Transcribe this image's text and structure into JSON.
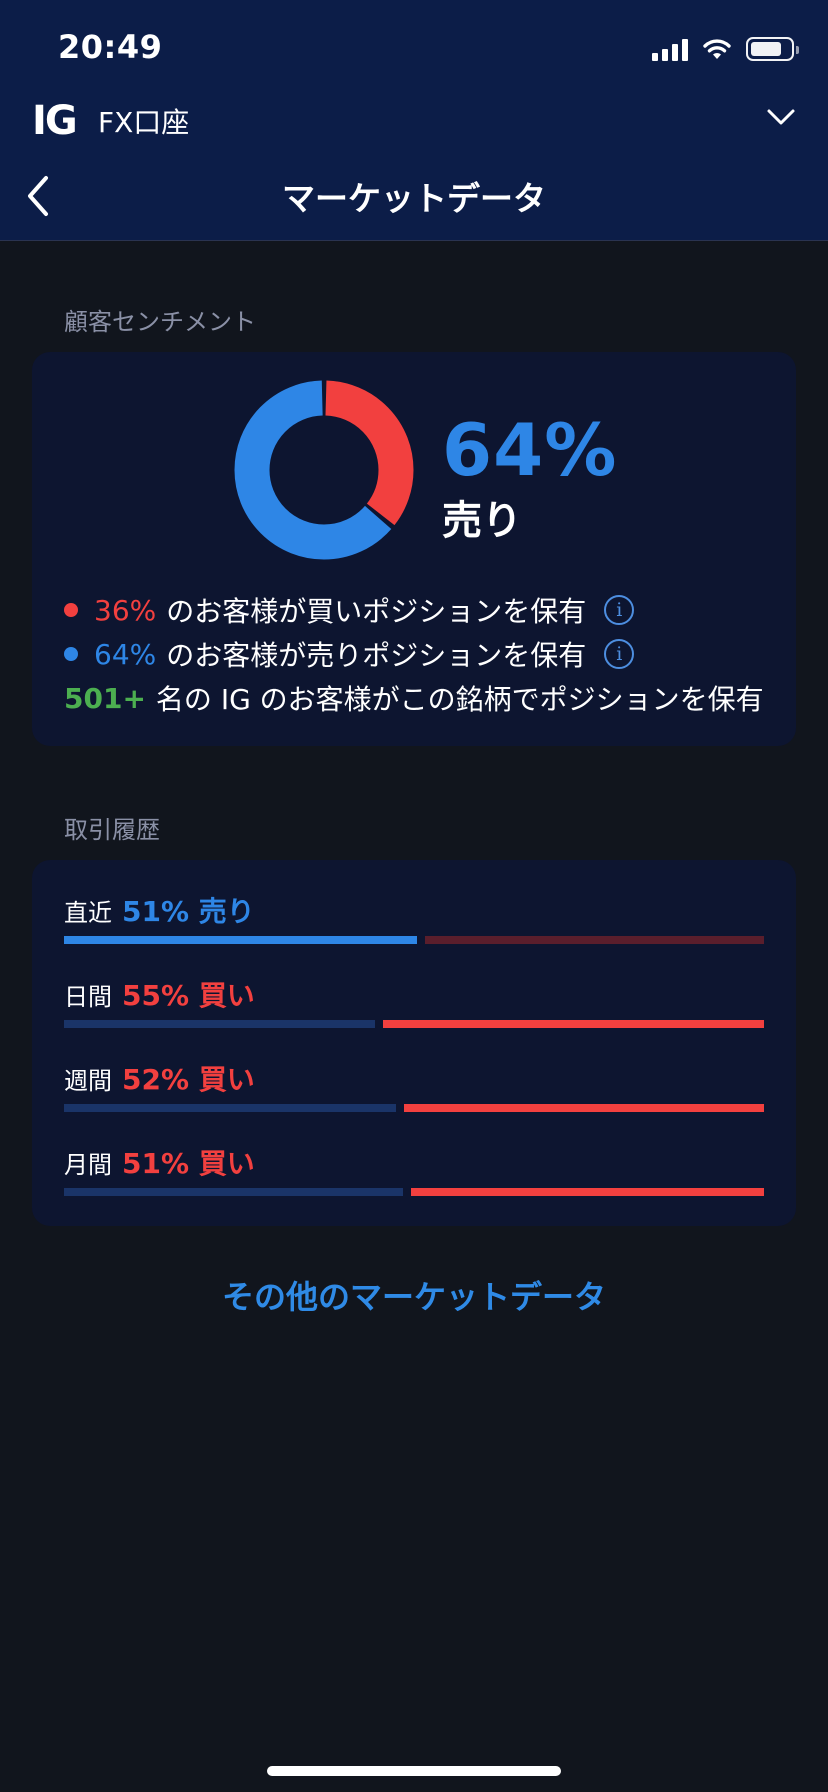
{
  "status_bar": {
    "time": "20:49"
  },
  "header": {
    "logo": "IG",
    "account": "FX口座",
    "title": "マーケットデータ"
  },
  "sentiment": {
    "section_title": "顧客センチメント",
    "big_pct": "64%",
    "big_label": "売り",
    "buy_fraction": 0.36,
    "sell_fraction": 0.64,
    "colors": {
      "buy": "#f2403f",
      "sell": "#2e86e6",
      "count": "#4caf50"
    },
    "rows": [
      {
        "pct": "36%",
        "text": "のお客様が買いポジションを保有"
      },
      {
        "pct": "64%",
        "text": "のお客様が売りポジションを保有"
      }
    ],
    "info_glyph": "i",
    "count": {
      "value": "501+",
      "text": "名の IG のお客様がこの銘柄でポジションを保有"
    }
  },
  "history": {
    "section_title": "取引履歴",
    "rows": [
      {
        "period": "直近",
        "value": "51% 売り",
        "side": "sell",
        "sell_fraction": 0.51
      },
      {
        "period": "日間",
        "value": "55% 買い",
        "side": "buy",
        "sell_fraction": 0.45
      },
      {
        "period": "週間",
        "value": "52% 買い",
        "side": "buy",
        "sell_fraction": 0.48
      },
      {
        "period": "月間",
        "value": "51% 買い",
        "side": "buy",
        "sell_fraction": 0.49
      }
    ]
  },
  "more_link": "その他のマーケットデータ"
}
